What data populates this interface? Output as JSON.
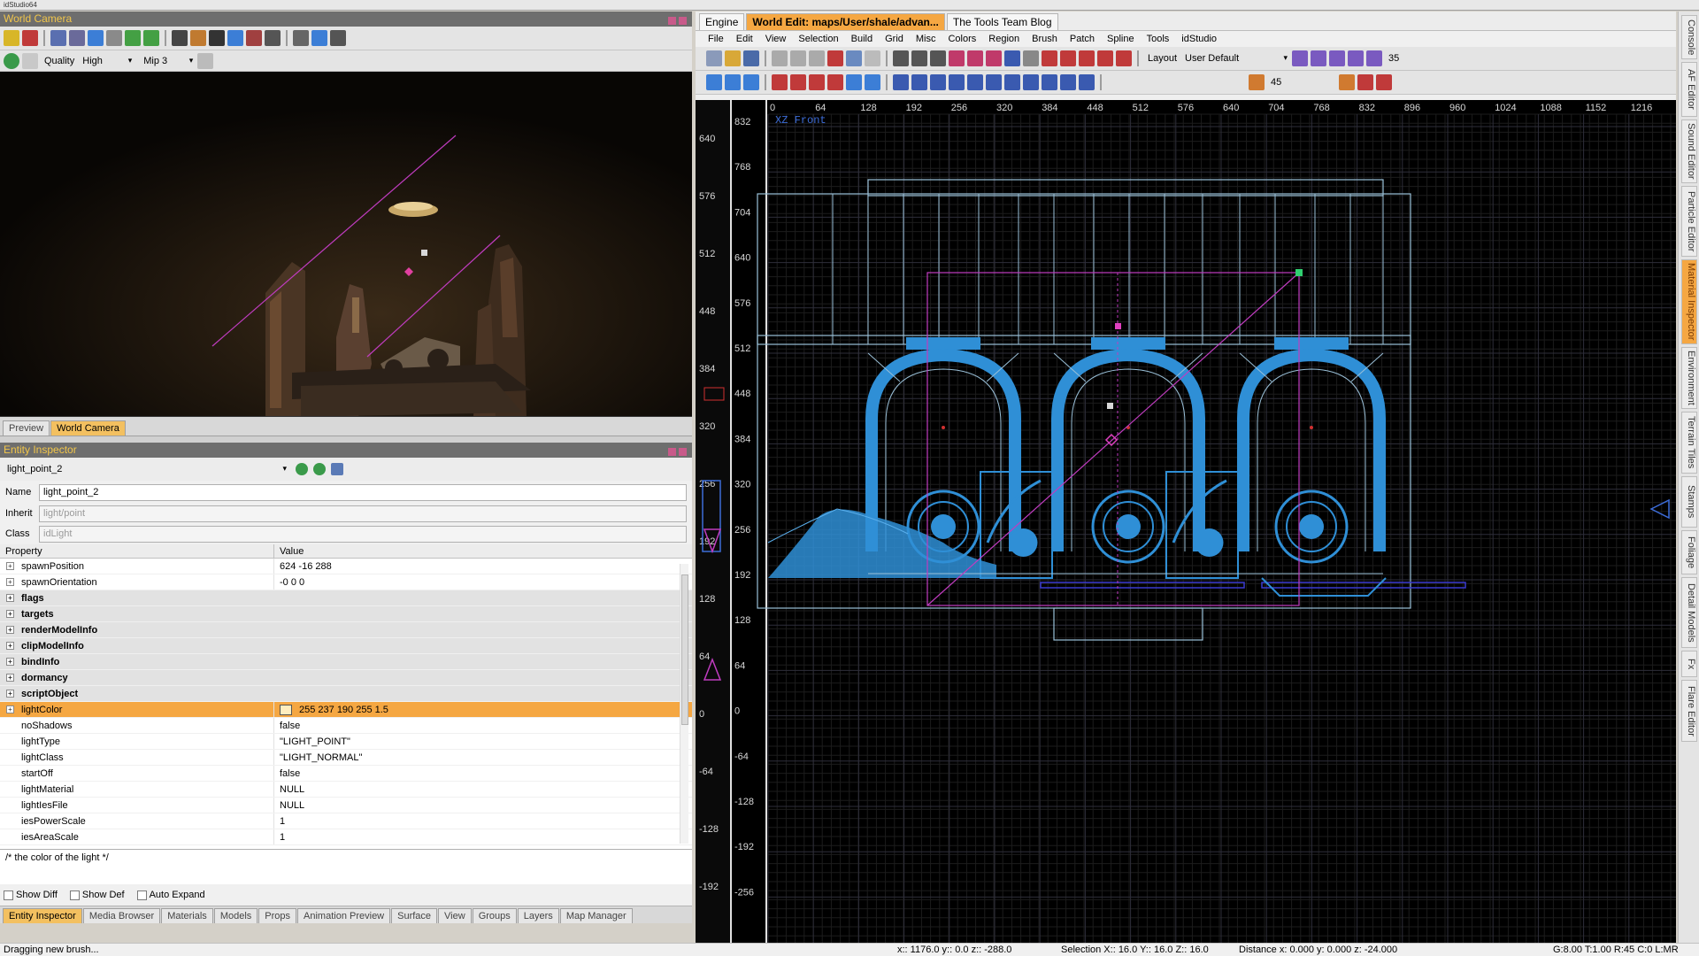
{
  "window": {
    "title": "idStudio64"
  },
  "world_camera": {
    "header": "World Camera",
    "quality_label": "Quality",
    "quality_value": "High",
    "mip_value": "Mip 3",
    "tabs": [
      "Preview",
      "World Camera"
    ],
    "active_tab": "World Camera"
  },
  "entity_inspector": {
    "header": "Entity Inspector",
    "entity_select": "light_point_2",
    "name_label": "Name",
    "name_value": "light_point_2",
    "inherit_label": "Inherit",
    "inherit_value": "light/point",
    "class_label": "Class",
    "class_value": "idLight",
    "col_property": "Property",
    "col_value": "Value",
    "properties": [
      {
        "key": "spawnPosition",
        "value": "624 -16 288",
        "type": "expand"
      },
      {
        "key": "spawnOrientation",
        "value": "-0 0 0",
        "type": "expand"
      },
      {
        "key": "flags",
        "value": "",
        "type": "group"
      },
      {
        "key": "targets",
        "value": "",
        "type": "group"
      },
      {
        "key": "renderModelInfo",
        "value": "",
        "type": "group"
      },
      {
        "key": "clipModelInfo",
        "value": "",
        "type": "group"
      },
      {
        "key": "bindInfo",
        "value": "",
        "type": "group"
      },
      {
        "key": "dormancy",
        "value": "",
        "type": "group"
      },
      {
        "key": "scriptObject",
        "value": "",
        "type": "group"
      },
      {
        "key": "lightColor",
        "value": "255 237 190 255   1.5",
        "type": "selected"
      },
      {
        "key": "noShadows",
        "value": "false",
        "type": "plain"
      },
      {
        "key": "lightType",
        "value": "\"LIGHT_POINT\"",
        "type": "plain"
      },
      {
        "key": "lightClass",
        "value": "\"LIGHT_NORMAL\"",
        "type": "plain"
      },
      {
        "key": "startOff",
        "value": "false",
        "type": "plain"
      },
      {
        "key": "lightMaterial",
        "value": "NULL",
        "type": "plain"
      },
      {
        "key": "lightIesFile",
        "value": "NULL",
        "type": "plain"
      },
      {
        "key": "iesPowerScale",
        "value": "1",
        "type": "plain"
      },
      {
        "key": "iesAreaScale",
        "value": "1",
        "type": "plain"
      }
    ],
    "description": "/* the color of the light */",
    "show_diff": "Show Diff",
    "show_def": "Show Def",
    "auto_expand": "Auto Expand"
  },
  "bottom_tabs": [
    "Entity Inspector",
    "Media Browser",
    "Materials",
    "Models",
    "Props",
    "Animation Preview",
    "Surface",
    "View",
    "Groups",
    "Layers",
    "Map Manager"
  ],
  "status": {
    "message": "Dragging new brush...",
    "coords": "x:: 1176.0  y:: 0.0  z:: -288.0",
    "selection": "Selection X:: 16.0  Y:: 16.0  Z:: 16.0",
    "distance": "Distance x: 0.000  y: 0.000  z: -24.000",
    "grid_info": "G:8.00 T:1.00 R:45 C:0 L:MR"
  },
  "world_edit": {
    "doc_tabs": [
      "Engine",
      "World Edit: maps/User/shale/advan...",
      "The Tools Team Blog"
    ],
    "active_tab": "World Edit: maps/User/shale/advan...",
    "menu": [
      "File",
      "Edit",
      "View",
      "Selection",
      "Build",
      "Grid",
      "Misc",
      "Colors",
      "Region",
      "Brush",
      "Patch",
      "Spline",
      "Tools",
      "idStudio"
    ],
    "layout_label": "Layout",
    "layout_value": "User Default",
    "rotate_value": "35",
    "angle_value": "45",
    "view_label": "XZ Front",
    "x_ticks": [
      "0",
      "64",
      "128",
      "192",
      "256",
      "320",
      "384",
      "448",
      "512",
      "576",
      "640",
      "704",
      "768",
      "832",
      "896",
      "960",
      "1024",
      "1088",
      "1152",
      "1216"
    ],
    "y_ticks_inner": [
      "832",
      "768",
      "704",
      "640",
      "576",
      "512",
      "448",
      "384",
      "320",
      "256",
      "192",
      "128",
      "64",
      "0",
      "-64",
      "-128",
      "-192",
      "-256"
    ],
    "y_ticks_outer": [
      "640",
      "576",
      "512",
      "448",
      "384",
      "320",
      "256",
      "192",
      "128",
      "64",
      "0",
      "-64",
      "-128",
      "-192"
    ]
  },
  "side_tabs": [
    "Console",
    "AF Editor",
    "Sound Editor",
    "Particle Editor",
    "Material Inspector",
    "Environment",
    "Terrain Tiles",
    "Stamps",
    "Foliage",
    "Detail Models",
    "Fx",
    "Flare Editor"
  ],
  "colors": {
    "accent": "#f5a742",
    "header_text": "#f2c64a",
    "wire_blue": "#2f8fd6",
    "selection_magenta": "#c03cc0"
  }
}
